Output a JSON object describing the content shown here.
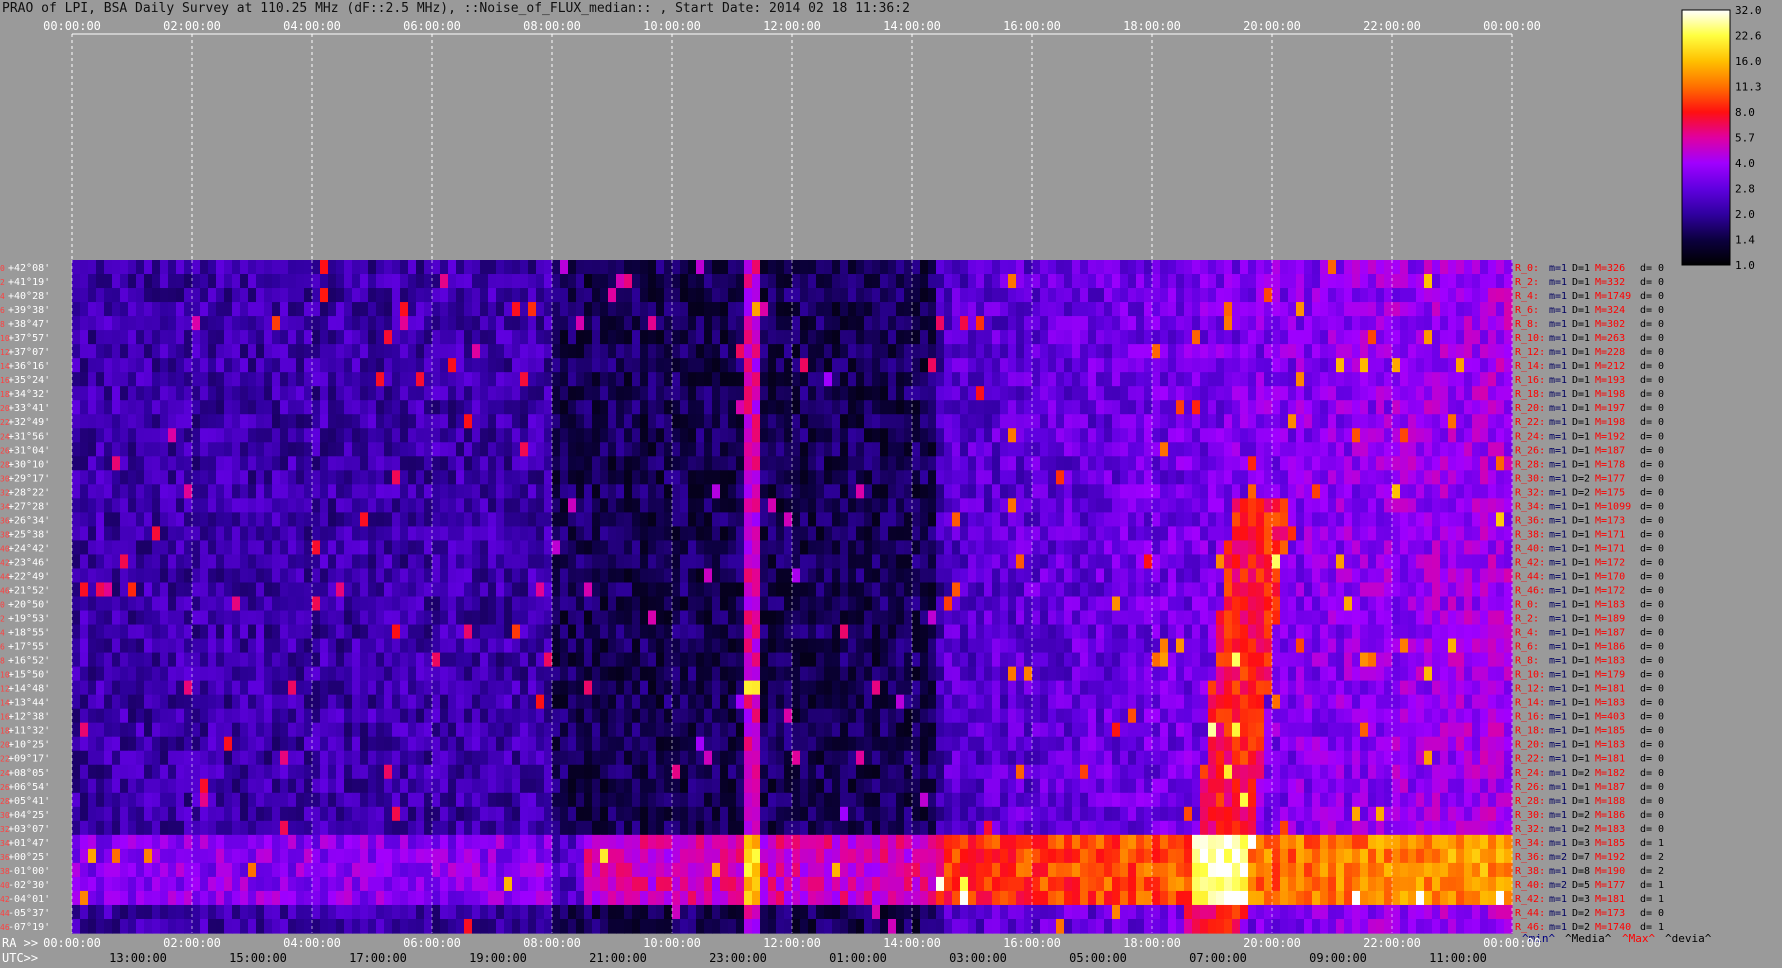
{
  "title": "PRAO of LPI, BSA Daily Survey at 110.25 MHz (dF::2.5 MHz), ::Noise_of_FLUX_median:: , Start Date: 2014 02 18 11:36:2",
  "chart_data": {
    "type": "heatmap",
    "top_axis_ticks": [
      "00:00:00",
      "02:00:00",
      "04:00:00",
      "06:00:00",
      "08:00:00",
      "10:00:00",
      "12:00:00",
      "14:00:00",
      "16:00:00",
      "18:00:00",
      "20:00:00",
      "22:00:00",
      "00:00:00"
    ],
    "ra_axis_label": "RA >>",
    "ra_ticks": [
      "00:00:00",
      "02:00:00",
      "04:00:00",
      "06:00:00",
      "08:00:00",
      "10:00:00",
      "12:00:00",
      "14:00:00",
      "16:00:00",
      "18:00:00",
      "20:00:00",
      "22:00:00",
      "00:00:00"
    ],
    "utc_axis_label": "UTC>>",
    "utc_ticks": [
      "13:00:00",
      "15:00:00",
      "17:00:00",
      "19:00:00",
      "21:00:00",
      "23:00:00",
      "01:00:00",
      "03:00:00",
      "05:00:00",
      "07:00:00",
      "09:00:00",
      "11:00:00"
    ],
    "declinations": [
      "+42°08'",
      "+41°19'",
      "+40°28'",
      "+39°38'",
      "+38°47'",
      "+37°57'",
      "+37°07'",
      "+36°16'",
      "+35°24'",
      "+34°32'",
      "+33°41'",
      "+32°49'",
      "+31°56'",
      "+31°04'",
      "+30°10'",
      "+29°17'",
      "+28°22'",
      "+27°28'",
      "+26°34'",
      "+25°38'",
      "+24°42'",
      "+23°46'",
      "+22°49'",
      "+21°52'",
      "+20°50'",
      "+19°53'",
      "+18°55'",
      "+17°55'",
      "+16°52'",
      "+15°50'",
      "+14°48'",
      "+13°44'",
      "+12°38'",
      "+11°32'",
      "+10°25'",
      "+09°17'",
      "+08°05'",
      "+06°54'",
      "+05°41'",
      "+04°25'",
      "+03°07'",
      "+01°47'",
      "+00°25'",
      "-01°00'",
      "-02°30'",
      "-04°01'",
      "-05°37'",
      "-07°19'"
    ],
    "beam_index_labels": [
      "0",
      "2",
      "4",
      "6",
      "8",
      "10",
      "12",
      "14",
      "16",
      "18",
      "20",
      "22",
      "24",
      "26",
      "28",
      "30",
      "32",
      "34",
      "36",
      "38",
      "40",
      "42",
      "44",
      "46",
      "0",
      "2",
      "4",
      "6",
      "8",
      "10",
      "12",
      "14",
      "16",
      "18",
      "20",
      "22",
      "24",
      "26",
      "28",
      "30",
      "32",
      "34",
      "36",
      "38",
      "40",
      "42",
      "44",
      "46"
    ],
    "row_stats": [
      {
        "r": "R_0:",
        "m": "m=1",
        "D": "D=1",
        "M": "M=326",
        "d": "d= 0"
      },
      {
        "r": "R_2:",
        "m": "m=1",
        "D": "D=1",
        "M": "M=332",
        "d": "d= 0"
      },
      {
        "r": "R_4:",
        "m": "m=1",
        "D": "D=1",
        "M": "M=1749",
        "d": "d= 0"
      },
      {
        "r": "R_6:",
        "m": "m=1",
        "D": "D=1",
        "M": "M=324",
        "d": "d= 0"
      },
      {
        "r": "R_8:",
        "m": "m=1",
        "D": "D=1",
        "M": "M=302",
        "d": "d= 0"
      },
      {
        "r": "R_10:",
        "m": "m=1",
        "D": "D=1",
        "M": "M=263",
        "d": "d= 0"
      },
      {
        "r": "R_12:",
        "m": "m=1",
        "D": "D=1",
        "M": "M=228",
        "d": "d= 0"
      },
      {
        "r": "R_14:",
        "m": "m=1",
        "D": "D=1",
        "M": "M=212",
        "d": "d= 0"
      },
      {
        "r": "R_16:",
        "m": "m=1",
        "D": "D=1",
        "M": "M=193",
        "d": "d= 0"
      },
      {
        "r": "R_18:",
        "m": "m=1",
        "D": "D=1",
        "M": "M=198",
        "d": "d= 0"
      },
      {
        "r": "R_20:",
        "m": "m=1",
        "D": "D=1",
        "M": "M=197",
        "d": "d= 0"
      },
      {
        "r": "R_22:",
        "m": "m=1",
        "D": "D=1",
        "M": "M=198",
        "d": "d= 0"
      },
      {
        "r": "R_24:",
        "m": "m=1",
        "D": "D=1",
        "M": "M=192",
        "d": "d= 0"
      },
      {
        "r": "R_26:",
        "m": "m=1",
        "D": "D=1",
        "M": "M=187",
        "d": "d= 0"
      },
      {
        "r": "R_28:",
        "m": "m=1",
        "D": "D=1",
        "M": "M=178",
        "d": "d= 0"
      },
      {
        "r": "R_30:",
        "m": "m=1",
        "D": "D=2",
        "M": "M=177",
        "d": "d= 0"
      },
      {
        "r": "R_32:",
        "m": "m=1",
        "D": "D=2",
        "M": "M=175",
        "d": "d= 0"
      },
      {
        "r": "R_34:",
        "m": "m=1",
        "D": "D=1",
        "M": "M=1099",
        "d": "d= 0"
      },
      {
        "r": "R_36:",
        "m": "m=1",
        "D": "D=1",
        "M": "M=173",
        "d": "d= 0"
      },
      {
        "r": "R_38:",
        "m": "m=1",
        "D": "D=1",
        "M": "M=171",
        "d": "d= 0"
      },
      {
        "r": "R_40:",
        "m": "m=1",
        "D": "D=1",
        "M": "M=171",
        "d": "d= 0"
      },
      {
        "r": "R_42:",
        "m": "m=1",
        "D": "D=1",
        "M": "M=172",
        "d": "d= 0"
      },
      {
        "r": "R_44:",
        "m": "m=1",
        "D": "D=1",
        "M": "M=170",
        "d": "d= 0"
      },
      {
        "r": "R_46:",
        "m": "m=1",
        "D": "D=1",
        "M": "M=172",
        "d": "d= 0"
      },
      {
        "r": "R_0:",
        "m": "m=1",
        "D": "D=1",
        "M": "M=183",
        "d": "d= 0"
      },
      {
        "r": "R_2:",
        "m": "m=1",
        "D": "D=1",
        "M": "M=189",
        "d": "d= 0"
      },
      {
        "r": "R_4:",
        "m": "m=1",
        "D": "D=1",
        "M": "M=187",
        "d": "d= 0"
      },
      {
        "r": "R_6:",
        "m": "m=1",
        "D": "D=1",
        "M": "M=186",
        "d": "d= 0"
      },
      {
        "r": "R_8:",
        "m": "m=1",
        "D": "D=1",
        "M": "M=183",
        "d": "d= 0"
      },
      {
        "r": "R_10:",
        "m": "m=1",
        "D": "D=1",
        "M": "M=179",
        "d": "d= 0"
      },
      {
        "r": "R_12:",
        "m": "m=1",
        "D": "D=1",
        "M": "M=181",
        "d": "d= 0"
      },
      {
        "r": "R_14:",
        "m": "m=1",
        "D": "D=1",
        "M": "M=183",
        "d": "d= 0"
      },
      {
        "r": "R_16:",
        "m": "m=1",
        "D": "D=1",
        "M": "M=403",
        "d": "d= 0"
      },
      {
        "r": "R_18:",
        "m": "m=1",
        "D": "D=1",
        "M": "M=185",
        "d": "d= 0"
      },
      {
        "r": "R_20:",
        "m": "m=1",
        "D": "D=1",
        "M": "M=183",
        "d": "d= 0"
      },
      {
        "r": "R_22:",
        "m": "m=1",
        "D": "D=1",
        "M": "M=181",
        "d": "d= 0"
      },
      {
        "r": "R_24:",
        "m": "m=1",
        "D": "D=2",
        "M": "M=182",
        "d": "d= 0"
      },
      {
        "r": "R_26:",
        "m": "m=1",
        "D": "D=1",
        "M": "M=187",
        "d": "d= 0"
      },
      {
        "r": "R_28:",
        "m": "m=1",
        "D": "D=1",
        "M": "M=188",
        "d": "d= 0"
      },
      {
        "r": "R_30:",
        "m": "m=1",
        "D": "D=2",
        "M": "M=186",
        "d": "d= 0"
      },
      {
        "r": "R_32:",
        "m": "m=1",
        "D": "D=2",
        "M": "M=183",
        "d": "d= 0"
      },
      {
        "r": "R_34:",
        "m": "m=1",
        "D": "D=3",
        "M": "M=185",
        "d": "d= 1"
      },
      {
        "r": "R_36:",
        "m": "m=2",
        "D": "D=7",
        "M": "M=192",
        "d": "d= 2"
      },
      {
        "r": "R_38:",
        "m": "m=1",
        "D": "D=8",
        "M": "M=190",
        "d": "d= 2"
      },
      {
        "r": "R_40:",
        "m": "m=2",
        "D": "D=5",
        "M": "M=177",
        "d": "d= 1"
      },
      {
        "r": "R_42:",
        "m": "m=1",
        "D": "D=3",
        "M": "M=181",
        "d": "d= 1"
      },
      {
        "r": "R_44:",
        "m": "m=1",
        "D": "D=2",
        "M": "M=173",
        "d": "d= 0"
      },
      {
        "r": "R_46:",
        "m": "m=1",
        "D": "D=2",
        "M": "M=1740",
        "d": "d= 1"
      }
    ],
    "stats_legend": [
      "^min^",
      "^Media^",
      "^Max^",
      "^devia^"
    ],
    "colorbar": {
      "ticks": [
        "32.0",
        "22.6",
        "16.0",
        "11.3",
        "8.0",
        "5.7",
        "4.0",
        "2.8",
        "2.0",
        "1.4",
        "1.0"
      ],
      "colors": [
        "#ffffff",
        "#ffff40",
        "#ffc000",
        "#ff7000",
        "#ff1010",
        "#e000a0",
        "#a000ff",
        "#6000e0",
        "#3000a0",
        "#0c0040",
        "#000000"
      ]
    }
  }
}
